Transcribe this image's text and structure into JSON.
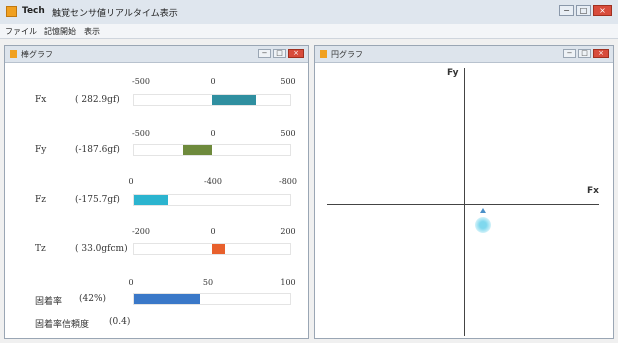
{
  "window": {
    "app_name": "Tech",
    "title": "触覚センサ値リアルタイム表示",
    "buttons": [
      "−",
      "□",
      "×"
    ]
  },
  "menu": [
    "ファイル",
    "記憶開始",
    "表示"
  ],
  "left_panel": {
    "title": "棒グラフ",
    "buttons": [
      "−",
      "□",
      "×"
    ],
    "rows": [
      {
        "label": "Fx",
        "value_text": "( 282.9gf)",
        "ticks": [
          "-500",
          "0",
          "500"
        ],
        "min": -500,
        "max": 500,
        "value": 282.9,
        "color": "#2f8fa0"
      },
      {
        "label": "Fy",
        "value_text": "(-187.6gf)",
        "ticks": [
          "-500",
          "0",
          "500"
        ],
        "min": -500,
        "max": 500,
        "value": -187.6,
        "color": "#6e8a3c"
      },
      {
        "label": "Fz",
        "value_text": "(-175.7gf)",
        "ticks": [
          "0",
          "-400",
          "-800"
        ],
        "min": 0,
        "max": -800,
        "value": -175.7,
        "color": "#2bb4cf"
      },
      {
        "label": "Tz",
        "value_text": "( 33.0gfcm)",
        "ticks": [
          "-200",
          "0",
          "200"
        ],
        "min": -200,
        "max": 200,
        "value": 33.0,
        "color": "#e8602c"
      },
      {
        "label": "固着率",
        "value_text": "(42%)",
        "ticks": [
          "0",
          "50",
          "100"
        ],
        "min": 0,
        "max": 100,
        "value": 42,
        "color": "#3a78c8"
      }
    ],
    "reliability_label": "固着率信頼度",
    "reliability_value": "(0.4)"
  },
  "right_panel": {
    "title": "円グラフ",
    "buttons": [
      "−",
      "□",
      "×"
    ],
    "y_axis_label": "Fy",
    "x_axis_label": "Fx",
    "point_color": "#7fd8ee",
    "marker_color": "#4a90c8"
  }
}
